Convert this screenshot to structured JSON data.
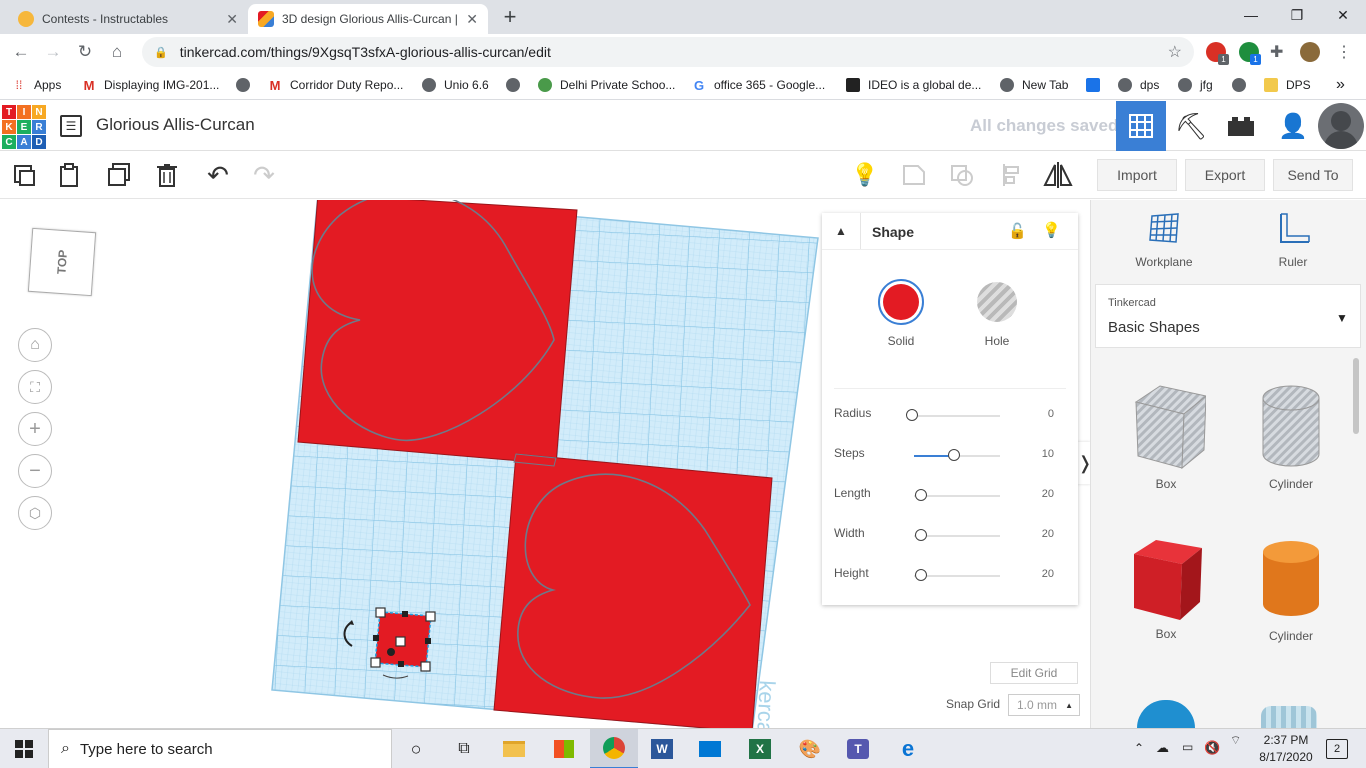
{
  "browser": {
    "tabs": [
      {
        "title": "Contests - Instructables",
        "active": false
      },
      {
        "title": "3D design Glorious Allis-Curcan |",
        "active": true
      }
    ],
    "new_tab": "+",
    "url": "tinkercad.com/things/9XgsqT3sfxA-glorious-allis-curcan/edit",
    "extension_badges": [
      "1",
      "1"
    ],
    "bookmarks": [
      {
        "label": "Apps",
        "icon": "apps-grid-icon"
      },
      {
        "label": "Displaying IMG-201...",
        "icon": "gmail-icon"
      },
      {
        "label": "",
        "icon": "globe-icon"
      },
      {
        "label": "Corridor Duty Repo...",
        "icon": "gmail-icon"
      },
      {
        "label": "Unio 6.6",
        "icon": "globe-icon"
      },
      {
        "label": "",
        "icon": "globe-icon"
      },
      {
        "label": "Delhi Private Schoo...",
        "icon": "school-icon"
      },
      {
        "label": "office 365 - Google...",
        "icon": "google-icon"
      },
      {
        "label": "IDEO is a global de...",
        "icon": "ideo-icon"
      },
      {
        "label": "New Tab",
        "icon": "globe-icon"
      },
      {
        "label": "dps",
        "icon": "globe-icon"
      },
      {
        "label": "jfg",
        "icon": "globe-icon"
      },
      {
        "label": "DPS",
        "icon": "folder-icon"
      }
    ],
    "more_bookmarks": "»"
  },
  "tinkercad": {
    "logo_letters": [
      "T",
      "I",
      "N",
      "K",
      "E",
      "R",
      "C",
      "A",
      "D"
    ],
    "design_name": "Glorious Allis-Curcan",
    "save_status": "All changes saved",
    "toolbar": {
      "import_label": "Import",
      "export_label": "Export",
      "sendto_label": "Send To"
    },
    "viewcube_label": "TOP",
    "shape_panel": {
      "title": "Shape",
      "solid_label": "Solid",
      "hole_label": "Hole",
      "solid_color": "#e31b23",
      "props": [
        {
          "label": "Radius",
          "value": "0",
          "level": 0
        },
        {
          "label": "Steps",
          "value": "10",
          "level": 0.45
        },
        {
          "label": "Length",
          "value": "20",
          "level": 0.08
        },
        {
          "label": "Width",
          "value": "20",
          "level": 0.08
        },
        {
          "label": "Height",
          "value": "20",
          "level": 0.08
        }
      ]
    },
    "edit_grid_label": "Edit Grid",
    "snap_grid_label": "Snap Grid",
    "snap_grid_value": "1.0 mm",
    "right_panel": {
      "workplane_label": "Workplane",
      "ruler_label": "Ruler",
      "library_source": "Tinkercad",
      "library_name": "Basic Shapes",
      "shapes": [
        {
          "label": "Box",
          "kind": "box-hole"
        },
        {
          "label": "Cylinder",
          "kind": "cylinder-hole"
        },
        {
          "label": "Box",
          "kind": "box-solid"
        },
        {
          "label": "Cylinder",
          "kind": "cylinder-solid"
        }
      ]
    }
  },
  "taskbar": {
    "search_placeholder": "Type here to search",
    "time": "2:37 PM",
    "date": "8/17/2020",
    "notification_count": "2"
  },
  "colors": {
    "tinkercad_red": "#e31b23",
    "workplane_blue": "#c8e8f8",
    "accent_blue": "#3a7fd5"
  }
}
